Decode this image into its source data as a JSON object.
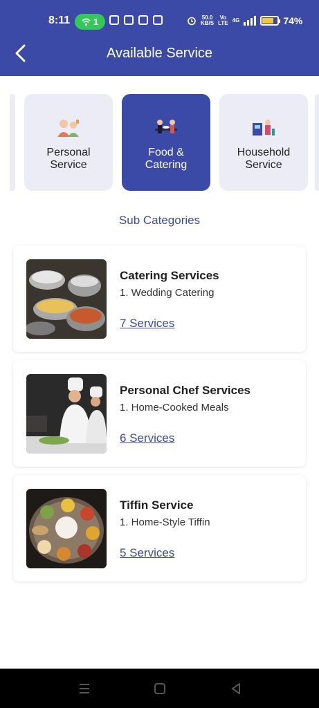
{
  "status_bar": {
    "time": "8:11",
    "hotspot_count": "1",
    "net_speed_top": "50.0",
    "net_speed_bottom": "KB/S",
    "volte_top": "Vo",
    "volte_bottom": "LTE",
    "network": "4G",
    "battery_percent": "74%",
    "battery_level": 0.74
  },
  "app_bar": {
    "title": "Available Service",
    "back_icon": "chevron-left-icon"
  },
  "categories": [
    {
      "label": "Personal\nService",
      "icon": "personal-service-icon",
      "active": false
    },
    {
      "label": "Food &\nCatering",
      "icon": "food-catering-icon",
      "active": true
    },
    {
      "label": "Household\nService",
      "icon": "household-service-icon",
      "active": false
    }
  ],
  "section_title": "Sub Categories",
  "services": [
    {
      "title": "Catering Services",
      "subtitle": "1. Wedding Catering",
      "link": "7 Services",
      "image": "catering-photo"
    },
    {
      "title": "Personal Chef Services",
      "subtitle": "1. Home-Cooked Meals",
      "link": "6 Services",
      "image": "chef-photo"
    },
    {
      "title": "Tiffin Service",
      "subtitle": "1. Home-Style Tiffin",
      "link": "5 Services",
      "image": "tiffin-photo"
    }
  ],
  "colors": {
    "primary": "#3a4aa6",
    "card_bg": "#ececf6",
    "hotspot": "#34c759",
    "battery": "#f5c542"
  }
}
